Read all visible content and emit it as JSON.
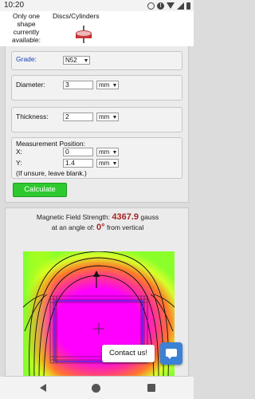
{
  "status_bar": {
    "time": "10:20",
    "icons": [
      "google-icon",
      "alert-icon",
      "wifi-icon",
      "signal-icon",
      "battery-icon"
    ]
  },
  "shape": {
    "note": "Only one shape currently available:",
    "name": "Discs/Cylinders",
    "icon": "disc-magnet-icon"
  },
  "form": {
    "grade": {
      "label": "Grade:",
      "value": "N52"
    },
    "diameter": {
      "label": "Diameter:",
      "value": "3",
      "unit": "mm"
    },
    "thickness": {
      "label": "Thickness:",
      "value": "2",
      "unit": "mm"
    },
    "position": {
      "label": "Measurement Position:",
      "x_label": "X:",
      "x_value": "0",
      "x_unit": "mm",
      "y_label": "Y:",
      "y_value": "1.4",
      "y_unit": "mm",
      "note": "(If unsure, leave blank.)"
    },
    "calculate_label": "Calculate",
    "calculate_color": "#2ec92e"
  },
  "result": {
    "strength_label": "Magnetic Field Strength:",
    "strength_value": "4367.9",
    "strength_unit": "gauss",
    "angle_prefix": "at an angle of:",
    "angle_value": "0°",
    "angle_suffix": "from vertical",
    "value_color": "#a52525"
  },
  "contact": {
    "label": "Contact us!",
    "icon": "chat-icon",
    "accent": "#3b82d6"
  },
  "nav": {
    "icons": [
      "back-icon",
      "home-icon",
      "recent-apps-icon"
    ]
  }
}
